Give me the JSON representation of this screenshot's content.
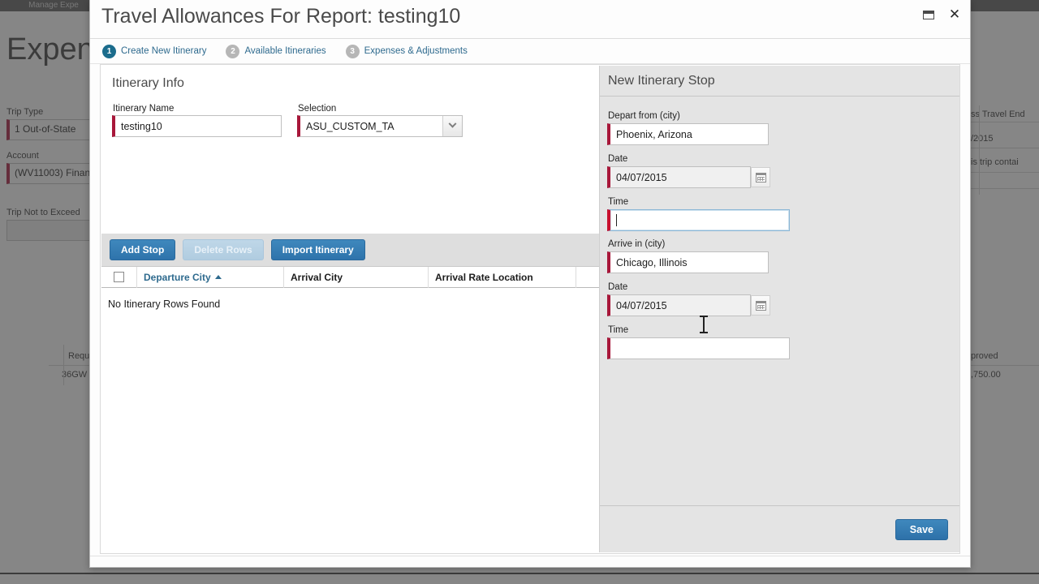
{
  "background": {
    "tab_label": "Manage Expe",
    "page_title": "Expen",
    "fields": [
      {
        "label": "Trip Type",
        "value": "1  Out-of-State"
      },
      {
        "label": "Account",
        "value": "(WV11003) Finan"
      },
      {
        "label": "Trip Not to Exceed",
        "value": ""
      }
    ],
    "right_texts": [
      "ss Travel End",
      "/2015",
      "is trip contai",
      "proved",
      ",750.00"
    ],
    "left_texts": [
      "Requ",
      "36GW"
    ]
  },
  "dialog": {
    "title": "Travel Allowances For Report: testing10",
    "window_controls": {
      "restore_label": "restore-window",
      "close_label": "close-window"
    },
    "steps": [
      {
        "number": "1",
        "label": "Create New Itinerary",
        "active": true
      },
      {
        "number": "2",
        "label": "Available Itineraries",
        "active": false
      },
      {
        "number": "3",
        "label": "Expenses & Adjustments",
        "active": false
      }
    ],
    "itinerary_info": {
      "section_title": "Itinerary Info",
      "itinerary_name": {
        "label": "Itinerary Name",
        "value": "testing10"
      },
      "selection": {
        "label": "Selection",
        "value": "ASU_CUSTOM_TA"
      }
    },
    "toolbar": {
      "add_stop": "Add Stop",
      "delete_rows": "Delete Rows",
      "delete_rows_disabled": true,
      "import_itinerary": "Import Itinerary"
    },
    "grid": {
      "columns": [
        {
          "label": "Departure City",
          "sorted": true,
          "sort_dir": "asc"
        },
        {
          "label": "Arrival City",
          "sorted": false
        },
        {
          "label": "Arrival Rate Location",
          "sorted": false
        }
      ],
      "empty_message": "No Itinerary Rows Found"
    },
    "new_stop": {
      "section_title": "New Itinerary Stop",
      "depart_city": {
        "label": "Depart from (city)",
        "value": "Phoenix, Arizona"
      },
      "depart_date": {
        "label": "Date",
        "value": "04/07/2015"
      },
      "depart_time": {
        "label": "Time",
        "value": "",
        "focused": true
      },
      "arrive_city": {
        "label": "Arrive in (city)",
        "value": "Chicago, Illinois"
      },
      "arrive_date": {
        "label": "Date",
        "value": "04/07/2015"
      },
      "arrive_time": {
        "label": "Time",
        "value": ""
      },
      "save_label": "Save"
    }
  },
  "colors": {
    "accent_blue": "#2e73ab",
    "required_red": "#a8173a",
    "step_active": "#1b6c8c",
    "link_blue": "#2e6a8e"
  }
}
